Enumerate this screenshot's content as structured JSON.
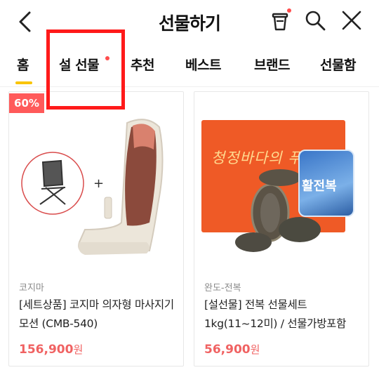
{
  "header": {
    "title": "선물하기"
  },
  "tabs": [
    {
      "label": "홈",
      "selected": true
    },
    {
      "label": "설 선물",
      "has_dot": true
    },
    {
      "label": "추천"
    },
    {
      "label": "베스트"
    },
    {
      "label": "브랜드"
    },
    {
      "label": "선물함"
    }
  ],
  "products": [
    {
      "discount": "60%",
      "brand": "코지마",
      "name": "[세트상품] 코지마 의자형 마사지기 모션 (CMB-540)",
      "price": "156,900",
      "currency": "원"
    },
    {
      "brand": "완도-전복",
      "name": "[설선물] 전복 선물세트 1kg(11~12미) / 선물가방포함",
      "price": "56,900",
      "currency": "원",
      "box_text": "청정바다의 푸른",
      "bag_text": "활전복"
    }
  ],
  "colors": {
    "accent_yellow": "#f9c400",
    "price_red": "#f06262",
    "discount_bg": "#ff5a5a",
    "highlight_red": "#ff1a1a"
  },
  "icons": [
    "back-arrow-icon",
    "gift-cup-icon",
    "search-icon",
    "close-icon"
  ]
}
